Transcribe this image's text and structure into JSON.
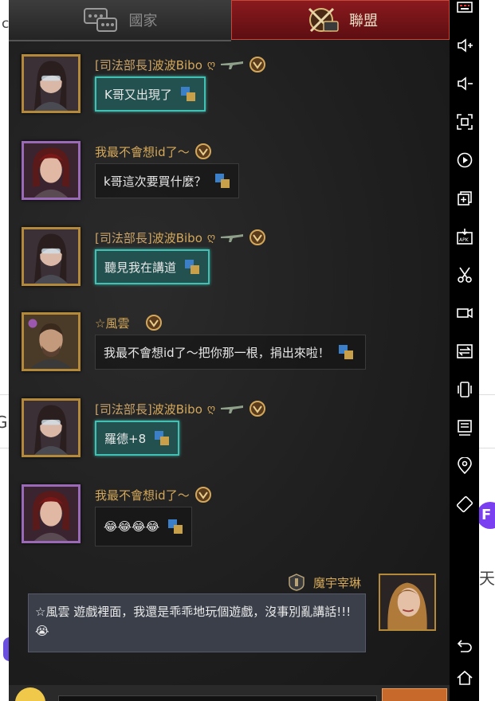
{
  "background": {
    "frag_left_top": "c",
    "frag_left_mid": "G",
    "frag_right_mid": "天",
    "fab_letter": "F"
  },
  "tabs": [
    {
      "label": "國家",
      "active": false
    },
    {
      "label": "聯盟",
      "active": true
    }
  ],
  "messages": [
    {
      "rank": "[司法部長]",
      "name": "波波Bibo",
      "ego": "ღ",
      "text": "K哥又出現了",
      "style": "teal"
    },
    {
      "rank": "",
      "name": "我最不會想id了～",
      "ego": "",
      "text": "k哥這次要買什麼？",
      "style": "dark"
    },
    {
      "rank": "[司法部長]",
      "name": "波波Bibo",
      "ego": "ღ",
      "text": "聽見我在講道",
      "style": "teal"
    },
    {
      "rank": "",
      "name": "☆風雲",
      "ego": "",
      "text": "我最不會想id了～把你那一根，捐出來啦！",
      "style": "dark"
    },
    {
      "rank": "[司法部長]",
      "name": "波波Bibo",
      "ego": "ღ",
      "text": "羅德+8",
      "style": "teal"
    },
    {
      "rank": "",
      "name": "我最不會想id了～",
      "ego": "",
      "text": "😂😂😂😂",
      "style": "dark"
    }
  ],
  "own_message": {
    "name": "魔宇宰琳",
    "text": "☆風雲 遊戲裡面，我還是乖乖地玩個遊戲，沒事別亂講話!!!",
    "emoji": "😭"
  },
  "colors": {
    "accent_gold": "#d4a85a",
    "teal_bubble": "#23514f",
    "alliance_tab": "#8a1a1e"
  },
  "sidebar_icons": [
    "keyboard-icon",
    "volume-up-icon",
    "volume-down-icon",
    "screenshot-icon",
    "record-icon",
    "multi-window-icon",
    "apk-install-icon",
    "scissors-icon",
    "video-icon",
    "sync-icon",
    "shake-icon",
    "desktop-icon",
    "location-icon",
    "rotate-icon",
    "back-icon",
    "home-icon"
  ]
}
